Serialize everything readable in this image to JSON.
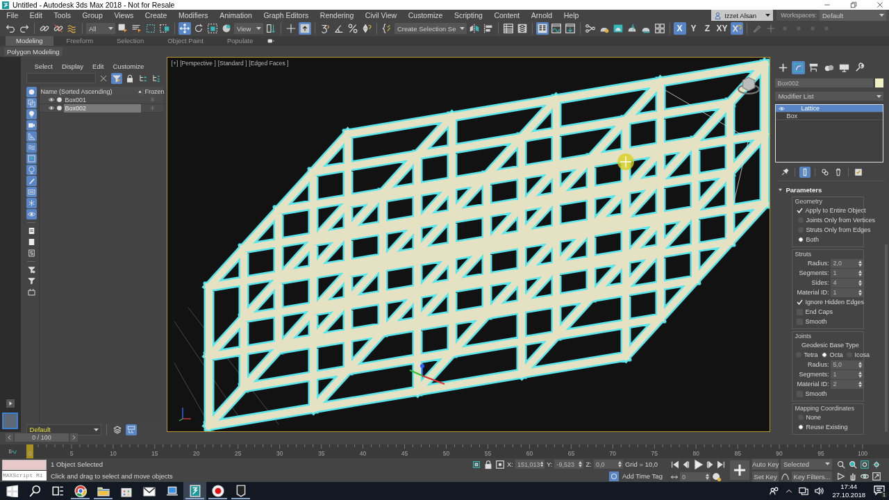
{
  "window": {
    "title": "Untitled - Autodesk 3ds Max 2018 - Not for Resale"
  },
  "menu_bar": {
    "items": [
      "File",
      "Edit",
      "Tools",
      "Group",
      "Views",
      "Create",
      "Modifiers",
      "Animation",
      "Graph Editors",
      "Rendering",
      "Civil View",
      "Customize",
      "Scripting",
      "Content",
      "Arnold",
      "Help"
    ],
    "user": "Izzet Alsan",
    "workspaces_label": "Workspaces:",
    "workspace": "Default"
  },
  "main_toolbar": {
    "items": [
      {
        "kind": "undo",
        "selected": false
      },
      {
        "kind": "redo",
        "selected": false
      },
      {
        "kind": "sep"
      },
      {
        "kind": "link",
        "selected": false
      },
      {
        "kind": "unlink",
        "selected": false
      },
      {
        "kind": "bind",
        "selected": false
      },
      {
        "kind": "sep"
      },
      {
        "kind": "dropdown",
        "value": "All"
      },
      {
        "kind": "select",
        "selected": false
      },
      {
        "kind": "select_name",
        "selected": false
      },
      {
        "kind": "region",
        "selected": false
      },
      {
        "kind": "crossing",
        "selected": false
      },
      {
        "kind": "sep"
      },
      {
        "kind": "move",
        "selected": true
      },
      {
        "kind": "rotate",
        "selected": false
      },
      {
        "kind": "scale",
        "selected": false
      },
      {
        "kind": "place",
        "selected": false
      },
      {
        "kind": "dropdown",
        "value": "View"
      },
      {
        "kind": "pivot",
        "selected": false
      },
      {
        "kind": "sep"
      },
      {
        "kind": "manipulate",
        "selected": false
      },
      {
        "kind": "keyboard",
        "selected": true
      },
      {
        "kind": "sep"
      },
      {
        "kind": "snap",
        "selected": false
      },
      {
        "kind": "angle",
        "selected": false
      },
      {
        "kind": "percent",
        "selected": false
      },
      {
        "kind": "spinner",
        "selected": false
      },
      {
        "kind": "sep"
      },
      {
        "kind": "named",
        "selected": false
      },
      {
        "kind": "dropdown",
        "value": "Create Selection Se"
      },
      {
        "kind": "mirror",
        "selected": false
      },
      {
        "kind": "align",
        "selected": false
      },
      {
        "kind": "sep"
      },
      {
        "kind": "table",
        "selected": false
      },
      {
        "kind": "layers",
        "selected": false
      },
      {
        "kind": "sep"
      },
      {
        "kind": "ribbon",
        "selected": true
      },
      {
        "kind": "curve",
        "selected": false
      },
      {
        "kind": "schematic",
        "selected": false
      },
      {
        "kind": "sep"
      },
      {
        "kind": "material",
        "selected": false
      },
      {
        "kind": "rsetup",
        "selected": false
      },
      {
        "kind": "rframe",
        "selected": false
      },
      {
        "kind": "render",
        "selected": false
      },
      {
        "kind": "riter",
        "selected": false
      },
      {
        "kind": "grid4",
        "selected": false
      },
      {
        "kind": "sep"
      },
      {
        "kind": "axis",
        "label": "X",
        "selected": true
      },
      {
        "kind": "axis",
        "label": "Y",
        "selected": false
      },
      {
        "kind": "axis",
        "label": "Z",
        "selected": false
      },
      {
        "kind": "axis",
        "label": "XY",
        "selected": false
      },
      {
        "kind": "axisq",
        "selected": true
      },
      {
        "kind": "sep"
      },
      {
        "kind": "brush",
        "selected": false
      },
      {
        "kind": "plus_dim",
        "selected": false
      },
      {
        "kind": "dot",
        "selected": false
      },
      {
        "kind": "dot",
        "selected": false
      },
      {
        "kind": "dot",
        "selected": false
      },
      {
        "kind": "dot",
        "selected": false
      }
    ]
  },
  "ribbon": {
    "tabs": [
      {
        "label": "Modeling",
        "selected": true
      },
      {
        "label": "Freeform",
        "selected": false
      },
      {
        "label": "Selection",
        "selected": false
      },
      {
        "label": "Object Paint",
        "selected": false
      },
      {
        "label": "Populate",
        "selected": false
      }
    ],
    "panel": "Polygon Modeling"
  },
  "scene_explorer": {
    "menus": [
      "Select",
      "Display",
      "Edit",
      "Customize"
    ],
    "tools": [
      {
        "kind": "clear",
        "selected": false
      },
      {
        "kind": "filter",
        "selected": true
      },
      {
        "kind": "lock",
        "selected": false
      },
      {
        "kind": "hier1",
        "selected": false
      },
      {
        "kind": "hier2",
        "selected": false
      }
    ],
    "filters": [
      {
        "kind": "f_geo",
        "selected": true
      },
      {
        "kind": "f_shape",
        "selected": true
      },
      {
        "kind": "f_light",
        "selected": true
      },
      {
        "kind": "f_cam",
        "selected": true
      },
      {
        "kind": "f_helper",
        "selected": true
      },
      {
        "kind": "f_warp",
        "selected": true
      },
      {
        "kind": "f_group",
        "selected": true
      },
      {
        "kind": "f_xref",
        "selected": true
      },
      {
        "kind": "f_bone",
        "selected": true
      },
      {
        "kind": "f_cont",
        "selected": true
      },
      {
        "kind": "f_frozen",
        "selected": true
      },
      {
        "kind": "f_hidden",
        "selected": true
      },
      {
        "kind": "sep"
      },
      {
        "kind": "f_page",
        "selected": false
      },
      {
        "kind": "f_blank",
        "selected": false
      },
      {
        "kind": "f_script",
        "selected": false
      },
      {
        "kind": "sep"
      },
      {
        "kind": "f_fgear",
        "selected": false
      },
      {
        "kind": "f_filter",
        "selected": false
      },
      {
        "kind": "f_box",
        "selected": false
      }
    ],
    "columns": [
      "Name (Sorted Ascending)",
      "Frozen"
    ],
    "rows": [
      {
        "name": "Box001",
        "selected": false
      },
      {
        "name": "Box002",
        "selected": true
      }
    ],
    "layer": "Default",
    "layer_tools": [
      {
        "kind": "layer_stack",
        "selected": false
      },
      {
        "kind": "layer_toggle",
        "selected": true
      }
    ]
  },
  "viewport": {
    "labels": [
      "[+]",
      "[Perspective ]",
      "[Standard ]",
      "[Edged Faces ]"
    ]
  },
  "command_panel": {
    "tabs": [
      {
        "kind": "cp_create",
        "selected": false
      },
      {
        "kind": "cp_modify",
        "selected": true
      },
      {
        "kind": "cp_hier",
        "selected": false
      },
      {
        "kind": "cp_motion",
        "selected": false
      },
      {
        "kind": "cp_display",
        "selected": false
      },
      {
        "kind": "cp_util",
        "selected": false
      }
    ],
    "object_name": "Box002",
    "modifier_list": "Modifier List",
    "stack": [
      {
        "kind": "modifier",
        "name": "Lattice",
        "selected": true
      },
      {
        "kind": "base",
        "name": "Box",
        "selected": false
      }
    ],
    "stack_tools": [
      {
        "kind": "pin",
        "selected": false
      },
      {
        "kind": "sep"
      },
      {
        "kind": "show_end",
        "selected": true
      },
      {
        "kind": "sep"
      },
      {
        "kind": "unique",
        "selected": false
      },
      {
        "kind": "remove",
        "selected": false
      },
      {
        "kind": "sep"
      },
      {
        "kind": "configure",
        "selected": false
      }
    ],
    "rollout": "Parameters",
    "groups": [
      {
        "title": "Geometry",
        "items": [
          {
            "kind": "checkbox",
            "label": "Apply to Entire Object",
            "checked": true
          },
          {
            "kind": "radio",
            "label": "Joints Only from Vertices",
            "selected": false
          },
          {
            "kind": "radio",
            "label": "Struts Only from Edges",
            "selected": false
          },
          {
            "kind": "radio",
            "label": "Both",
            "selected": true
          }
        ]
      },
      {
        "title": "Struts",
        "items": [
          {
            "kind": "spinner",
            "label": "Radius:",
            "value": "2,0"
          },
          {
            "kind": "spinner",
            "label": "Segments:",
            "value": "1"
          },
          {
            "kind": "spinner",
            "label": "Sides:",
            "value": "4"
          },
          {
            "kind": "spinner",
            "label": "Material ID:",
            "value": "1"
          },
          {
            "kind": "checkbox",
            "label": "Ignore Hidden Edges",
            "checked": true
          },
          {
            "kind": "checkbox",
            "label": "End Caps",
            "checked": false
          },
          {
            "kind": "checkbox",
            "label": "Smooth",
            "checked": false
          }
        ]
      },
      {
        "title": "Joints",
        "items": [
          {
            "kind": "caption",
            "label": "Geodesic Base Type"
          },
          {
            "kind": "radio_row",
            "options": [
              {
                "label": "Tetra",
                "selected": false
              },
              {
                "label": "Octa",
                "selected": true
              },
              {
                "label": "Icosa",
                "selected": false
              }
            ]
          },
          {
            "kind": "spinner",
            "label": "Radius:",
            "value": "5,0"
          },
          {
            "kind": "spinner",
            "label": "Segments:",
            "value": "1"
          },
          {
            "kind": "spinner",
            "label": "Material ID:",
            "value": "2"
          },
          {
            "kind": "checkbox",
            "label": "Smooth",
            "checked": false
          }
        ]
      },
      {
        "title": "Mapping Coordinates",
        "items": [
          {
            "kind": "radio",
            "label": "None",
            "selected": false
          },
          {
            "kind": "radio",
            "label": "Reuse Existing",
            "selected": true
          }
        ]
      }
    ]
  },
  "time_slider": {
    "label": "0 / 100",
    "level": 0
  },
  "track_bar": {
    "labels": [
      "0",
      "5",
      "10",
      "15",
      "20",
      "25",
      "30",
      "35",
      "40",
      "45",
      "50",
      "55",
      "60",
      "65",
      "70",
      "75",
      "80",
      "85",
      "90",
      "95",
      "100"
    ]
  },
  "status_bar": {
    "listener": "MAXScript Mi",
    "selection": "1 Object Selected",
    "prompt": "Click and drag to select and move objects",
    "coords": [
      {
        "axis": "X:",
        "value": "151,013"
      },
      {
        "axis": "Y:",
        "value": "-9,523"
      },
      {
        "axis": "Z:",
        "value": "0,0"
      }
    ],
    "grid": "Grid = 10,0",
    "time_tag": "Add Time Tag",
    "frame": "0",
    "auto_key": "Auto Key",
    "key_set": "Selected",
    "set_key": "Set Key",
    "key_filters": "Key Filters..."
  },
  "taskbar": {
    "apps": [
      {
        "kind": "start",
        "running": false,
        "selected": false
      },
      {
        "kind": "search",
        "running": false,
        "selected": false
      },
      {
        "kind": "taskview",
        "running": false,
        "selected": false
      },
      {
        "kind": "browser",
        "running": true,
        "selected": false
      },
      {
        "kind": "folder",
        "running": true,
        "selected": false
      },
      {
        "kind": "store",
        "running": false,
        "selected": false
      },
      {
        "kind": "mail",
        "running": false,
        "selected": false
      },
      {
        "kind": "remote",
        "running": false,
        "selected": false
      },
      {
        "kind": "max",
        "running": true,
        "selected": true
      },
      {
        "kind": "record",
        "running": true,
        "selected": false
      },
      {
        "kind": "epic",
        "running": true,
        "selected": false
      }
    ],
    "time": "17:44",
    "date": "27.10.2018",
    "notifications": "1"
  }
}
